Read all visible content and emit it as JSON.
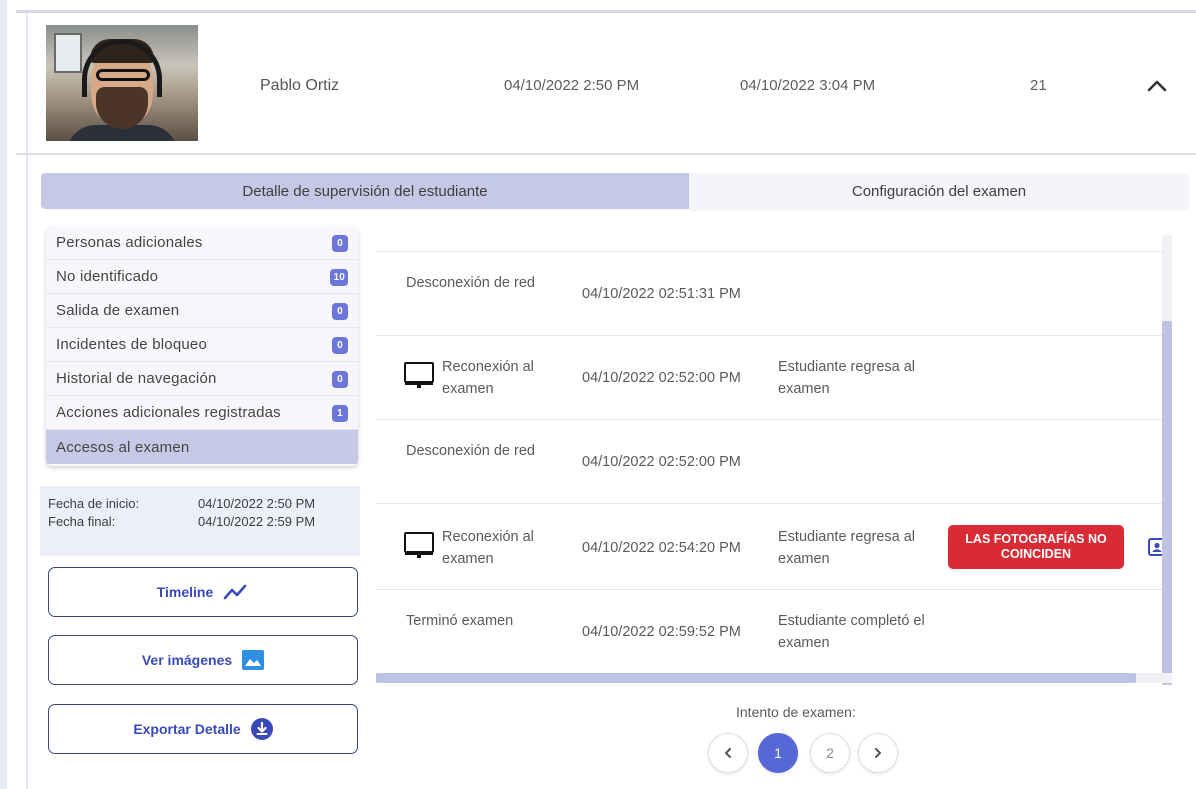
{
  "student": {
    "name": "Pablo Ortiz",
    "start": "04/10/2022 2:50 PM",
    "end": "04/10/2022 3:04 PM",
    "count": "21"
  },
  "tabs": {
    "detail": "Detalle de supervisión del estudiante",
    "config": "Configuración del examen"
  },
  "menu": [
    {
      "label": "Personas adicionales",
      "badge": "0"
    },
    {
      "label": "No identificado",
      "badge": "10"
    },
    {
      "label": "Salida de examen",
      "badge": "0"
    },
    {
      "label": "Incidentes de bloqueo",
      "badge": "0"
    },
    {
      "label": "Historial de navegación",
      "badge": "0"
    },
    {
      "label": "Acciones adicionales registradas",
      "badge": "1"
    },
    {
      "label": "Accesos al examen",
      "badge": ""
    }
  ],
  "dates": {
    "start_label": "Fecha de inicio:",
    "start_value": "04/10/2022 2:50 PM",
    "end_label": "Fecha final:",
    "end_value": "04/10/2022 2:59 PM"
  },
  "buttons": {
    "timeline": "Timeline",
    "images": "Ver imágenes",
    "export": "Exportar Detalle"
  },
  "events": [
    {
      "type": "Desconexión de red",
      "date": "04/10/2022 02:51:31 PM",
      "desc": "",
      "alert": "",
      "icon": ""
    },
    {
      "type": "Reconexión al examen",
      "date": "04/10/2022 02:52:00 PM",
      "desc": "Estudiante regresa al examen",
      "alert": "",
      "icon": "monitor-icon"
    },
    {
      "type": "Desconexión de red",
      "date": "04/10/2022 02:52:00 PM",
      "desc": "",
      "alert": "",
      "icon": ""
    },
    {
      "type": "Reconexión al examen",
      "date": "04/10/2022 02:54:20 PM",
      "desc": "Estudiante regresa al examen",
      "alert": "LAS FOTOGRAFÍAS NO COINCIDEN",
      "icon": "monitor-icon"
    },
    {
      "type": "Terminó examen",
      "date": "04/10/2022 02:59:52 PM",
      "desc": "Estudiante completó el examen",
      "alert": "",
      "icon": ""
    }
  ],
  "pagination": {
    "label": "Intento de examen:",
    "pages": [
      "1",
      "2"
    ],
    "current": "1"
  },
  "colors": {
    "accent": "#5568d6",
    "tab_active": "#c6c9e6",
    "alert": "#d92b35",
    "badge": "#6b76d8"
  }
}
